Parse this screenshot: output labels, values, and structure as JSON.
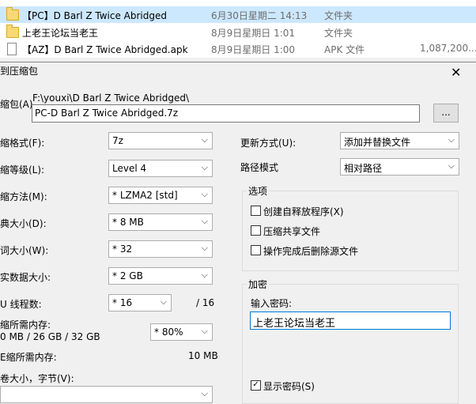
{
  "file_list": [
    {
      "name": "【PC】D Barl Z Twice Abridged",
      "date": "6月30日星期二 14:13",
      "type": "文件夹",
      "size": "",
      "icon": "folder-icon"
    },
    {
      "name": "上老王论坛当老王",
      "date": "8月9日星期日 1:01",
      "type": "文件夹",
      "size": "",
      "icon": "folder-icon"
    },
    {
      "name": "【AZ】D Barl Z Twice Abridged.apk",
      "date": "8月9日星期日 1:00",
      "type": "APK 文件",
      "size": "1,087,200...",
      "icon": "file-icon"
    }
  ],
  "dialog": {
    "title": "到压缩包",
    "close": "✕",
    "archive_label": "缩包(A)",
    "archive_path": "F:\\youxi\\D Barl Z Twice Abridged\\",
    "archive_name": "PC-D Barl Z Twice Abridged.7z",
    "browse_label": "...",
    "left": {
      "format_label": "缩格式(F):",
      "format_value": "7z",
      "level_label": "缩等级(L):",
      "level_value": "Level 4",
      "method_label": "缩方法(M):",
      "method_value": "* LZMA2 [std]",
      "dict_label": "典大小(D):",
      "dict_value": "* 8 MB",
      "word_label": "词大小(W):",
      "word_value": "* 32",
      "solid_label": "实数据大小:",
      "solid_value": "* 2 GB",
      "threads_label": "U 线程数:",
      "threads_value": "* 16",
      "threads_max": "/ 16",
      "mem_label": "缩所需内存:",
      "mem_detail": "0 MB / 26 GB / 32 GB",
      "mem_value": "* 80%",
      "decomp_label": "E缩所需内存:",
      "decomp_value": "10 MB",
      "split_label": "卷大小，字节(V):"
    },
    "right": {
      "update_label": "更新方式(U):",
      "update_value": "添加并替换文件",
      "pathmode_label": "路径模式",
      "pathmode_value": "相对路径",
      "options_title": "选项",
      "opt_sfx": "创建自释放程序(X)",
      "opt_shared": "压缩共享文件",
      "opt_delete": "操作完成后删除源文件",
      "enc_title": "加密",
      "pw_label": "输入密码:",
      "pw_value": "上老王论坛当老王",
      "show_pw": "显示密码(S)"
    }
  }
}
